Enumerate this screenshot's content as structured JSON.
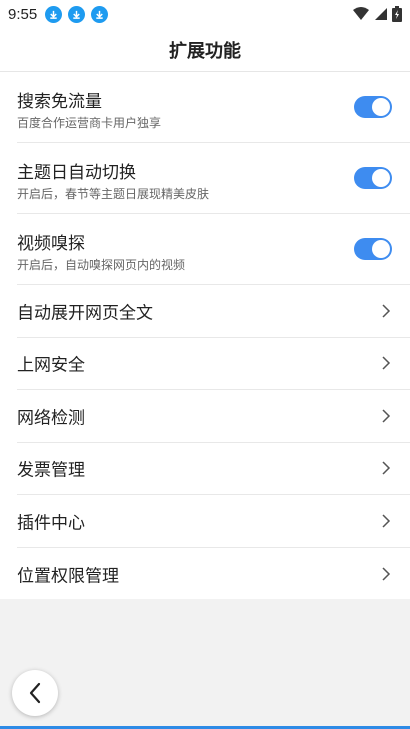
{
  "status_bar": {
    "time": "9:55",
    "icons": [
      "download-icon",
      "download-icon",
      "download-icon",
      "wifi-icon",
      "signal-icon",
      "battery-icon"
    ]
  },
  "header": {
    "title": "扩展功能"
  },
  "settings": {
    "toggles": [
      {
        "title": "搜索免流量",
        "subtitle": "百度合作运营商卡用户独享",
        "enabled": true
      },
      {
        "title": "主题日自动切换",
        "subtitle": "开启后，春节等主题日展现精美皮肤",
        "enabled": true
      },
      {
        "title": "视频嗅探",
        "subtitle": "开启后，自动嗅探网页内的视频",
        "enabled": true
      }
    ],
    "links": [
      {
        "title": "自动展开网页全文"
      },
      {
        "title": "上网安全"
      },
      {
        "title": "网络检测"
      },
      {
        "title": "发票管理"
      },
      {
        "title": "插件中心"
      },
      {
        "title": "位置权限管理"
      }
    ]
  },
  "colors": {
    "accent": "#3e8cf0",
    "download_badge": "#1e9bf0"
  },
  "footer": {
    "back_icon": "chevron-left-icon"
  }
}
